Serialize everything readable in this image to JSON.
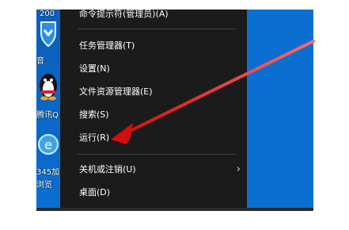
{
  "desktop": {
    "labels": [
      "200",
      "音",
      "腾讯Q",
      "345加",
      "浏览"
    ],
    "icon_names": [
      "year-icon",
      "shield-icon",
      "qq-penguin-icon",
      "ie-browser-icon"
    ]
  },
  "context_menu": {
    "top_item": "命令提示符(管理员)(A)",
    "items": [
      "任务管理器(T)",
      "设置(N)",
      "文件资源管理器(E)",
      "搜索(S)",
      "运行(R)"
    ],
    "group2": [
      "关机或注销(U)",
      "桌面(D)"
    ],
    "submenu_indicator": "›"
  },
  "colors": {
    "menu_bg": "#1b1b1b",
    "desktop_blue": "#0a6fd1",
    "arrow_red": "#e02020"
  }
}
